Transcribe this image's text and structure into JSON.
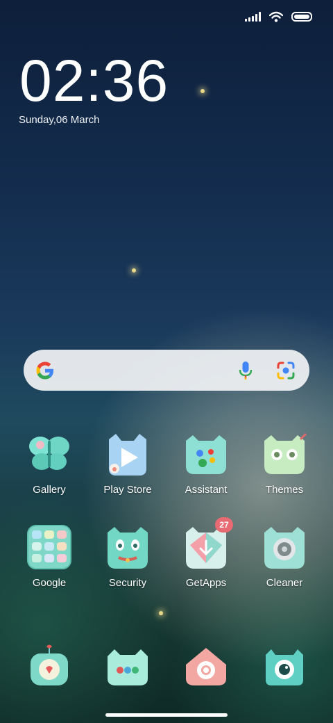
{
  "clock": {
    "time": "02:36",
    "date": "Sunday,06 March"
  },
  "search": {
    "logo": "google-g-icon",
    "mic": "mic-icon",
    "lens": "lens-icon"
  },
  "apps": [
    {
      "label": "Gallery",
      "icon": "gallery-icon"
    },
    {
      "label": "Play Store",
      "icon": "play-store-icon"
    },
    {
      "label": "Assistant",
      "icon": "assistant-icon"
    },
    {
      "label": "Themes",
      "icon": "themes-icon"
    },
    {
      "label": "Google",
      "icon": "google-folder-icon"
    },
    {
      "label": "Security",
      "icon": "security-icon"
    },
    {
      "label": "GetApps",
      "icon": "getapps-icon",
      "badge": "27"
    },
    {
      "label": "Cleaner",
      "icon": "cleaner-icon"
    }
  ],
  "dock": [
    {
      "icon": "phone-icon"
    },
    {
      "icon": "messages-icon"
    },
    {
      "icon": "chrome-icon"
    },
    {
      "icon": "camera-icon"
    }
  ],
  "colors": {
    "accent_teal": "#6fd6c6",
    "badge": "#e86a72"
  }
}
